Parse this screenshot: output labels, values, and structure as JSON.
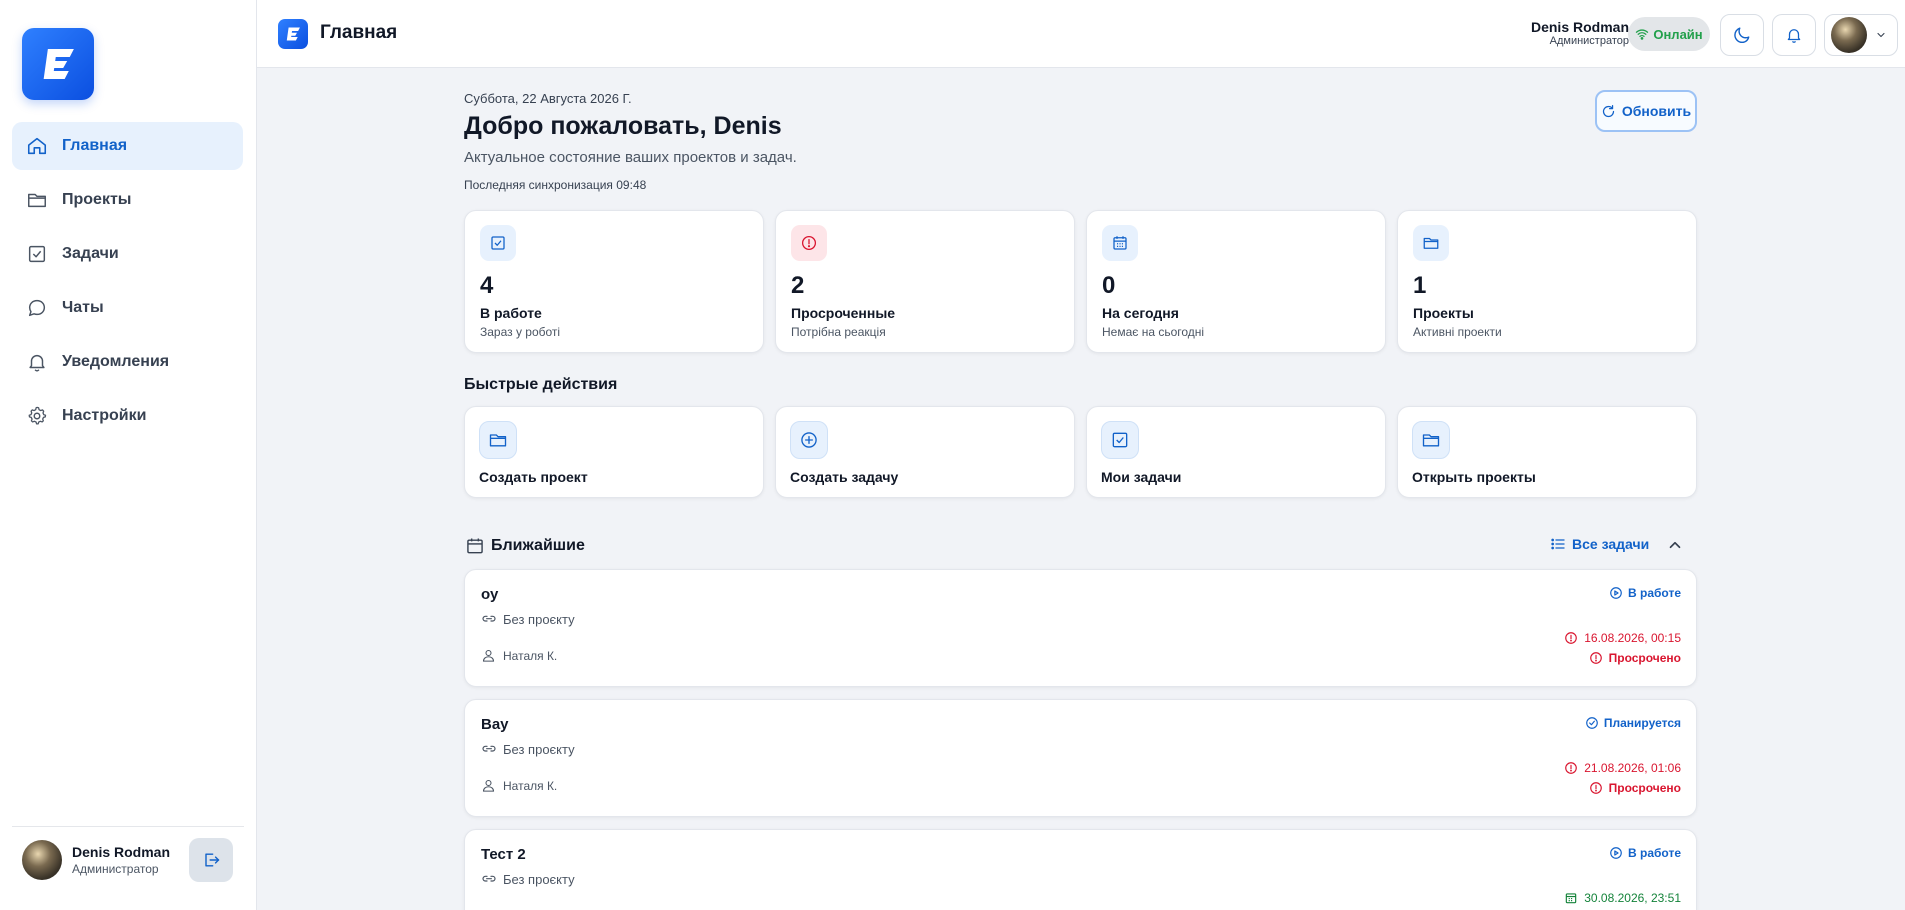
{
  "sidebar": {
    "logo_letter": "E",
    "items": [
      {
        "label": "Главная",
        "icon": "home-icon",
        "active": true
      },
      {
        "label": "Проекты",
        "icon": "folder-icon",
        "active": false
      },
      {
        "label": "Задачи",
        "icon": "checkbox-icon",
        "active": false
      },
      {
        "label": "Чаты",
        "icon": "chat-icon",
        "active": false
      },
      {
        "label": "Уведомления",
        "icon": "bell-icon",
        "active": false
      },
      {
        "label": "Настройки",
        "icon": "gear-icon",
        "active": false
      }
    ],
    "user": {
      "name": "Denis Rodman",
      "role": "Администратор"
    }
  },
  "header": {
    "logo_letter": "E",
    "title": "Главная",
    "user": {
      "name": "Denis Rodman",
      "role": "Администратор"
    },
    "online_label": "Онлайн"
  },
  "main": {
    "date": "Суббота, 22 Августа 2026 Г.",
    "welcome": "Добро пожаловать, Denis",
    "subtitle": "Актуальное состояние ваших проектов и задач.",
    "sync": "Последняя синхронизация 09:48",
    "refresh_label": "Обновить",
    "stats": [
      {
        "value": "4",
        "label": "В работе",
        "sub": "Зараз у роботі",
        "icon": "checkbox-icon"
      },
      {
        "value": "2",
        "label": "Просроченные",
        "sub": "Потрібна реакція",
        "icon": "alert-icon"
      },
      {
        "value": "0",
        "label": "На сегодня",
        "sub": "Немає на сьогодні",
        "icon": "calendar-icon"
      },
      {
        "value": "1",
        "label": "Проекты",
        "sub": "Активні проекти",
        "icon": "folder-icon"
      }
    ],
    "quick_actions_title": "Быстрые действия",
    "quick_actions": [
      {
        "label": "Создать проект",
        "icon": "folder-icon"
      },
      {
        "label": "Создать задачу",
        "icon": "plus-circle-icon"
      },
      {
        "label": "Мои задачи",
        "icon": "checkbox-icon"
      },
      {
        "label": "Открыть проекты",
        "icon": "folder-icon"
      }
    ],
    "upcoming": {
      "title": "Ближайшие",
      "all_tasks_label": "Все задачи",
      "tasks": [
        {
          "title": "оу",
          "project": "Без проєкту",
          "assignee": "Наталя К.",
          "status": "В работе",
          "date": "16.08.2026, 00:15",
          "overdue": "Просрочено"
        },
        {
          "title": "Вау",
          "project": "Без проєкту",
          "assignee": "Наталя К.",
          "status": "Планируется",
          "date": "21.08.2026, 01:06",
          "overdue": "Просрочено"
        },
        {
          "title": "Тест 2",
          "project": "Без проєкту",
          "assignee": "",
          "status": "В работе",
          "date": "30.08.2026, 23:51",
          "overdue": ""
        }
      ]
    }
  },
  "colors": {
    "accent": "#1262c9",
    "active_bg": "#e7f1fd",
    "danger": "#d9152f",
    "success": "#22a04b",
    "page_bg": "#f1f3f7"
  }
}
